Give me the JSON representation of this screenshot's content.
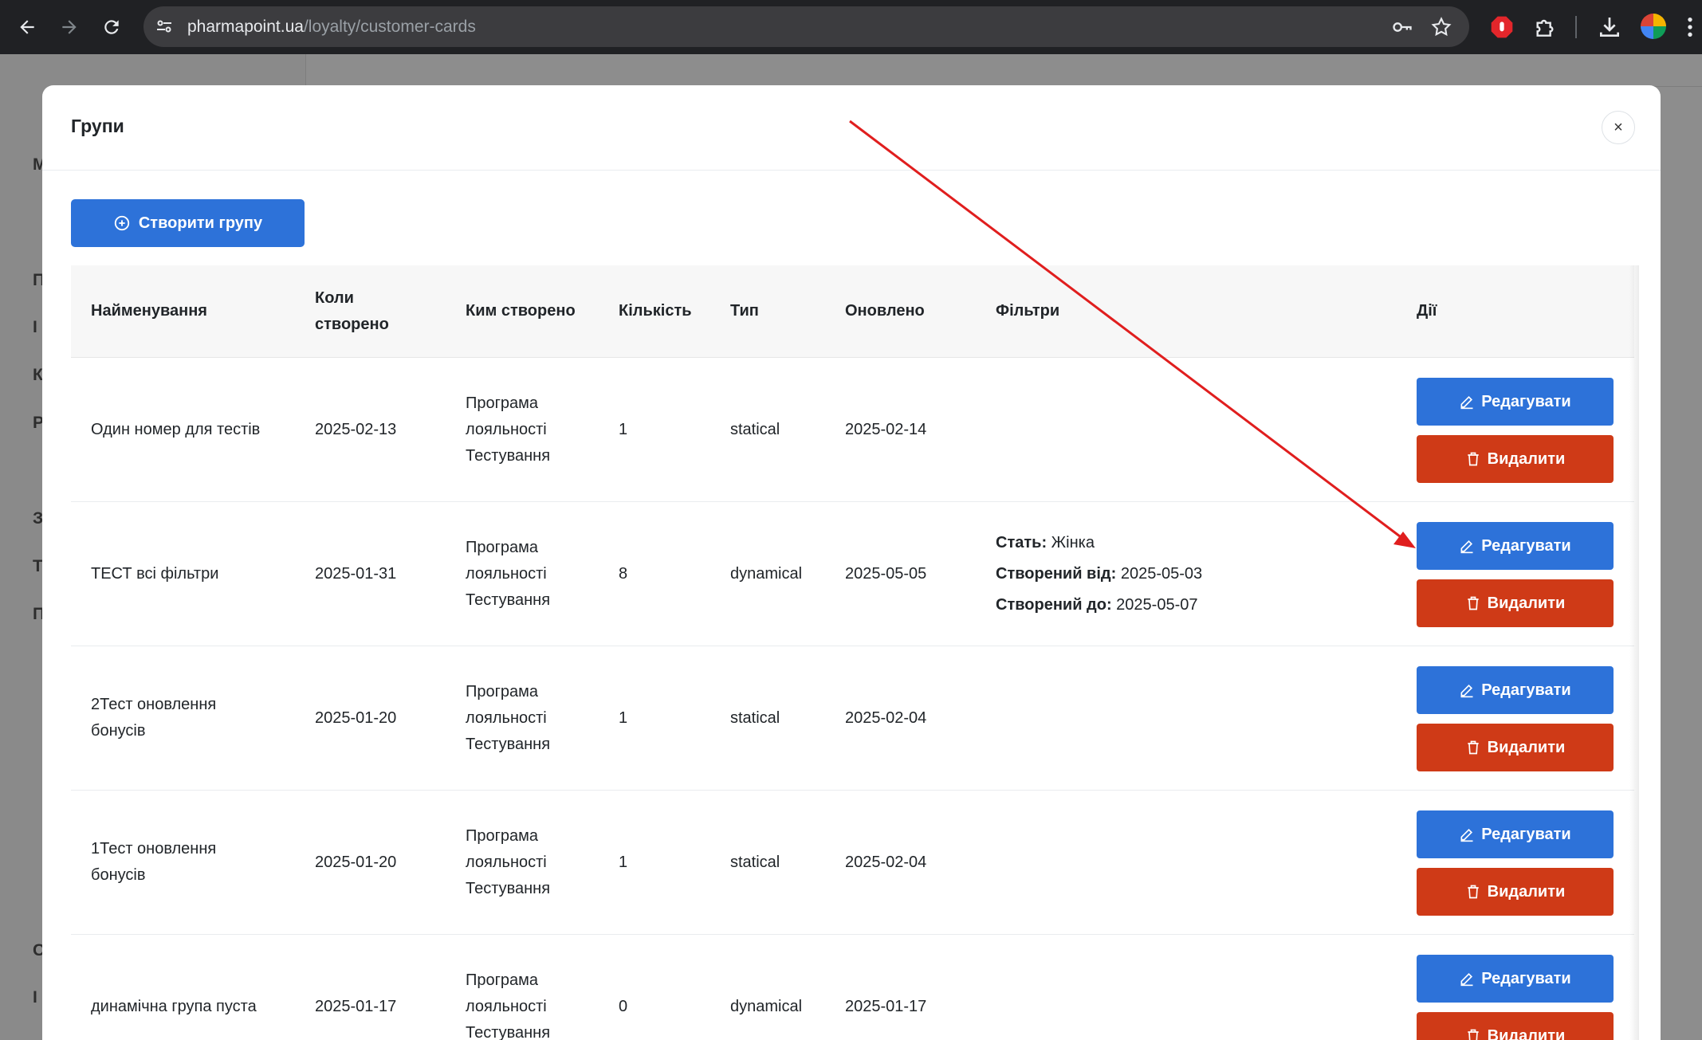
{
  "browser": {
    "url_host": "pharmapoint.ua",
    "url_path": "/loyalty/customer-cards"
  },
  "modal": {
    "title": "Групи",
    "close_label": "×",
    "create_button": "Створити групу"
  },
  "table": {
    "headers": {
      "name": "Найменування",
      "created_line1": "Коли",
      "created_line2": "створено",
      "author": "Ким створено",
      "count": "Кількість",
      "type": "Тип",
      "updated": "Оновлено",
      "filters": "Фільтри",
      "actions": "Дії"
    },
    "edit_label": "Редагувати",
    "delete_label": "Видалити",
    "rows": [
      {
        "name": "Один номер для тестів",
        "name2": "",
        "created": "2025-02-13",
        "author1": "Програма",
        "author2": "лояльності",
        "author3": "Тестування",
        "count": "1",
        "type": "statical",
        "updated": "2025-02-14",
        "f1k": "",
        "f1v": "",
        "f2k": "",
        "f2v": "",
        "f3k": "",
        "f3v": ""
      },
      {
        "name": "ТЕСТ всі фільтри",
        "name2": "",
        "created": "2025-01-31",
        "author1": "Програма",
        "author2": "лояльності",
        "author3": "Тестування",
        "count": "8",
        "type": "dynamical",
        "updated": "2025-05-05",
        "f1k": "Стать:",
        "f1v": " Жінка",
        "f2k": "Створений від:",
        "f2v": " 2025-05-03",
        "f3k": "Створений до:",
        "f3v": " 2025-05-07"
      },
      {
        "name": "2Тест оновлення",
        "name2": "бонусів",
        "created": "2025-01-20",
        "author1": "Програма",
        "author2": "лояльності",
        "author3": "Тестування",
        "count": "1",
        "type": "statical",
        "updated": "2025-02-04",
        "f1k": "",
        "f1v": "",
        "f2k": "",
        "f2v": "",
        "f3k": "",
        "f3v": ""
      },
      {
        "name": "1Тест оновлення",
        "name2": "бонусів",
        "created": "2025-01-20",
        "author1": "Програма",
        "author2": "лояльності",
        "author3": "Тестування",
        "count": "1",
        "type": "statical",
        "updated": "2025-02-04",
        "f1k": "",
        "f1v": "",
        "f2k": "",
        "f2v": "",
        "f3k": "",
        "f3v": ""
      },
      {
        "name": "динамічна група пуста",
        "name2": "",
        "created": "2025-01-17",
        "author1": "Програма",
        "author2": "лояльності",
        "author3": "Тестування",
        "count": "0",
        "type": "dynamical",
        "updated": "2025-01-17",
        "f1k": "",
        "f1v": "",
        "f2k": "",
        "f2v": "",
        "f3k": "",
        "f3v": ""
      }
    ]
  },
  "background_letters": [
    "M",
    "П",
    "І",
    "К",
    "Р",
    "З",
    "Т",
    "П",
    "С",
    "І"
  ],
  "annotation_color": "#e01e1e"
}
